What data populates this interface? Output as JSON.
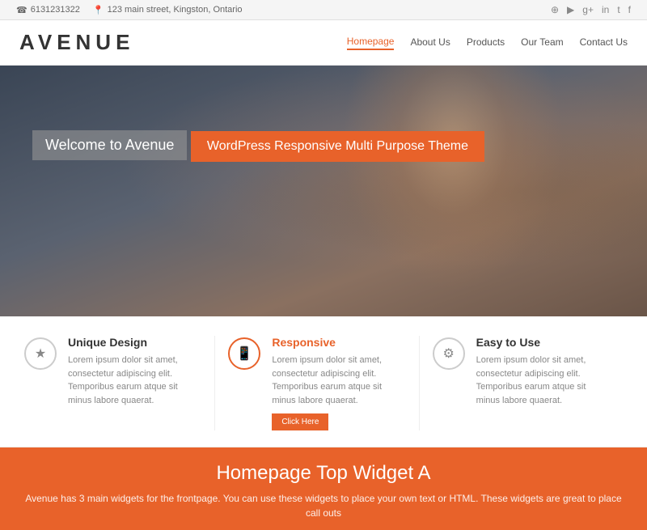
{
  "topbar": {
    "phone": "6131231322",
    "address": "123 main street, Kingston, Ontario",
    "phone_icon": "☎",
    "location_icon": "📍",
    "social_icons": [
      "pinterest",
      "youtube",
      "google-plus",
      "instagram",
      "twitter",
      "facebook"
    ]
  },
  "header": {
    "logo": "AVENUE",
    "nav": {
      "items": [
        {
          "label": "Homepage",
          "active": true
        },
        {
          "label": "About Us",
          "active": false
        },
        {
          "label": "Products",
          "active": false
        },
        {
          "label": "Our Team",
          "active": false
        },
        {
          "label": "Contact Us",
          "active": false
        }
      ]
    }
  },
  "hero": {
    "welcome": "Welcome to Avenue",
    "tagline": "WordPress Responsive Multi Purpose Theme"
  },
  "features": [
    {
      "icon": "★",
      "title": "Unique Design",
      "body": "Lorem ipsum dolor sit amet, consectetur adipiscing elit. Temporibus earum atque sit minus labore quaerat.",
      "accent": false,
      "has_button": false
    },
    {
      "icon": "📱",
      "title": "Responsive",
      "body": "Lorem ipsum dolor sit amet, consectetur adipiscing elit. Temporibus earum atque sit minus labore quaerat.",
      "accent": true,
      "has_button": true,
      "button_label": "Click Here"
    },
    {
      "icon": "⚙",
      "title": "Easy to Use",
      "body": "Lorem ipsum dolor sit amet, consectetur adipiscing elit. Temporibus earum atque sit minus labore quaerat.",
      "accent": false,
      "has_button": false
    }
  ],
  "bottom_widget": {
    "title": "Homepage Top Widget A",
    "description": "Avenue has 3 main widgets for the frontpage. You can use these widgets to place your own text or HTML.  These widgets are great to place call outs"
  },
  "colors": {
    "accent": "#e8622a",
    "text_dark": "#333333",
    "text_muted": "#888888",
    "bg_light": "#f5f5f5"
  }
}
